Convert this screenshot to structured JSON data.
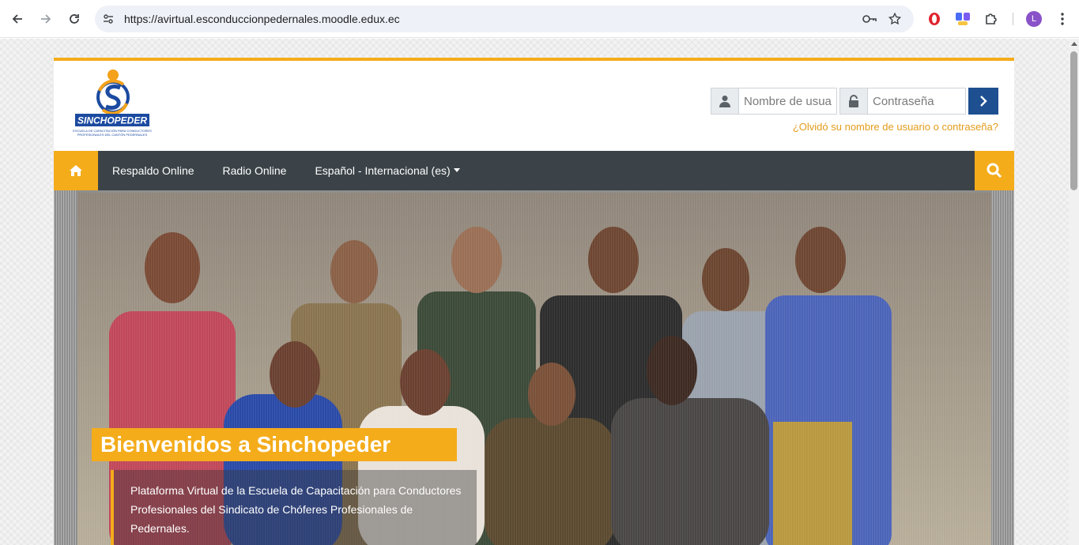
{
  "browser": {
    "url": "https://avirtual.esconduccionpedernales.moodle.edux.ec",
    "profile_initial": "L",
    "icons": [
      "back-arrow-icon",
      "forward-arrow-icon",
      "reload-icon",
      "site-settings-icon",
      "password-key-icon",
      "bookmark-star-icon",
      "opera-extension-icon",
      "translate-extension-icon",
      "puzzle-extensions-icon",
      "kebab-menu-icon"
    ]
  },
  "header": {
    "logo_text": "SINCHOPEDER",
    "logo_subtitle_line1": "ESCUELA DE CAPACITACIÓN PARA CONDUCTORES",
    "logo_subtitle_line2": "PROFESIONALES DEL CANTÓN PEDERNALES"
  },
  "login": {
    "username_placeholder": "Nombre de usuario",
    "password_placeholder": "Contraseña",
    "forgot_link": "¿Olvidó su nombre de usuario o contraseña?"
  },
  "nav": {
    "items": [
      {
        "label": "Respaldo Online"
      },
      {
        "label": "Radio Online"
      },
      {
        "label": "Español - Internacional (es)"
      }
    ]
  },
  "hero": {
    "title": "Bienvenidos a Sinchopeder",
    "description": "Plataforma Virtual de la Escuela de Capacitación para Conductores Profesionales del Sindicato de Chóferes Profesionales de Pedernales."
  },
  "colors": {
    "accent": "#f4ac1b",
    "navbar": "#3b4348",
    "submit": "#1d4f91",
    "link": "#e29c1b"
  }
}
